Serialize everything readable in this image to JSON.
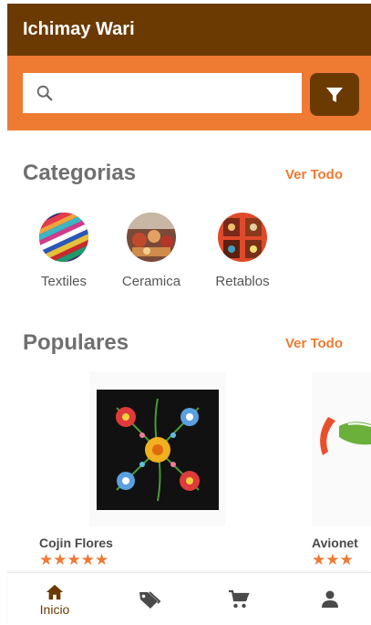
{
  "app": {
    "title": "Ichimay Wari"
  },
  "search": {
    "placeholder": "",
    "value": ""
  },
  "categories": {
    "title": "Categorias",
    "see_all": "Ver Todo",
    "items": [
      {
        "label": "Textiles"
      },
      {
        "label": "Ceramica"
      },
      {
        "label": "Retablos"
      }
    ]
  },
  "popular": {
    "title": "Populares",
    "see_all": "Ver Todo",
    "items": [
      {
        "name": "Cojin Flores",
        "stars": "★★★★★"
      },
      {
        "name": "Avionet",
        "stars": "★★★"
      }
    ]
  },
  "bottom_nav": {
    "items": [
      {
        "icon": "home-icon",
        "label": "Inicio",
        "active": true
      },
      {
        "icon": "tag-icon",
        "label": ""
      },
      {
        "icon": "cart-icon",
        "label": ""
      },
      {
        "icon": "person-icon",
        "label": ""
      }
    ]
  },
  "colors": {
    "brand_dark": "#6b3a03",
    "brand_orange": "#ef7a32",
    "heading_gray": "#6f6f6f"
  }
}
